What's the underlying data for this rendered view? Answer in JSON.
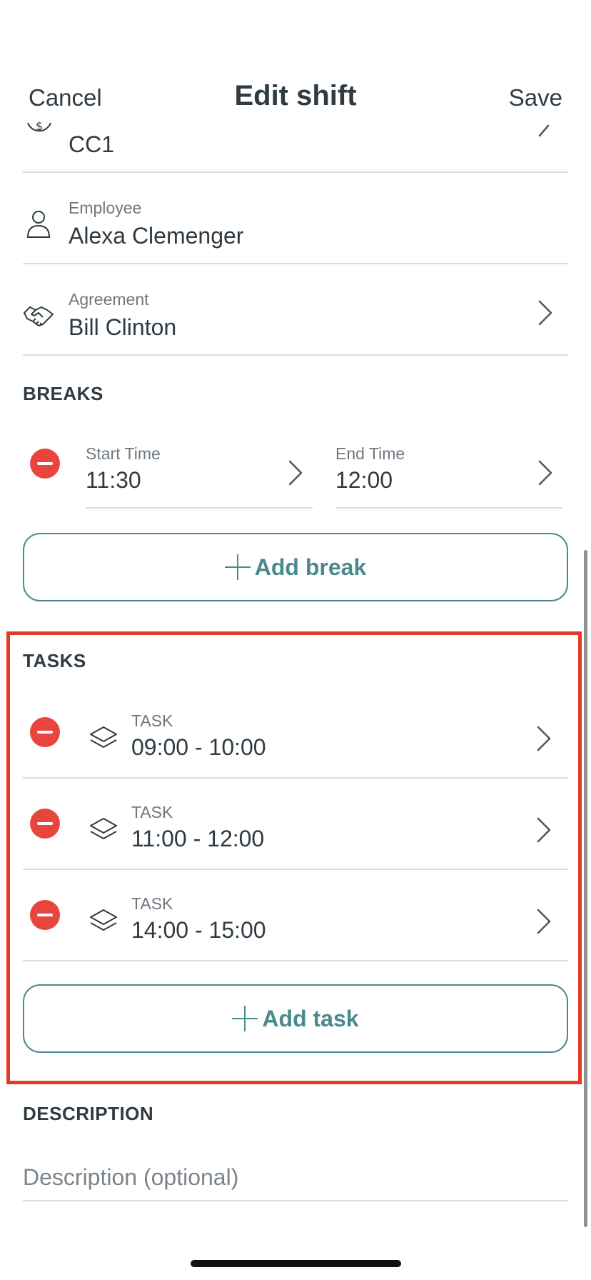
{
  "header": {
    "cancel_label": "Cancel",
    "title": "Edit shift",
    "save_label": "Save"
  },
  "fields": {
    "cost_center": {
      "value": "CC1",
      "icon": "dollar-circle-icon"
    },
    "employee": {
      "label": "Employee",
      "value": "Alexa Clemenger",
      "icon": "person-icon"
    },
    "agreement": {
      "label": "Agreement",
      "value": "Bill Clinton",
      "icon": "handshake-icon"
    }
  },
  "breaks": {
    "section_title": "BREAKS",
    "items": [
      {
        "start_label": "Start Time",
        "start_value": "11:30",
        "end_label": "End Time",
        "end_value": "12:00"
      }
    ],
    "add_label": "Add break"
  },
  "tasks": {
    "section_title": "TASKS",
    "items": [
      {
        "label": "TASK",
        "time": "09:00 - 10:00",
        "icon": "layers-icon"
      },
      {
        "label": "TASK",
        "time": "11:00 - 12:00",
        "icon": "layers-icon"
      },
      {
        "label": "TASK",
        "time": "14:00 - 15:00",
        "icon": "layers-icon"
      }
    ],
    "add_label": "Add task"
  },
  "description": {
    "section_title": "DESCRIPTION",
    "placeholder": "Description (optional)"
  },
  "colors": {
    "accent": "#4a8a8c",
    "danger": "#e8453c",
    "highlight": "#e53a27",
    "text": "#2f3a42"
  }
}
